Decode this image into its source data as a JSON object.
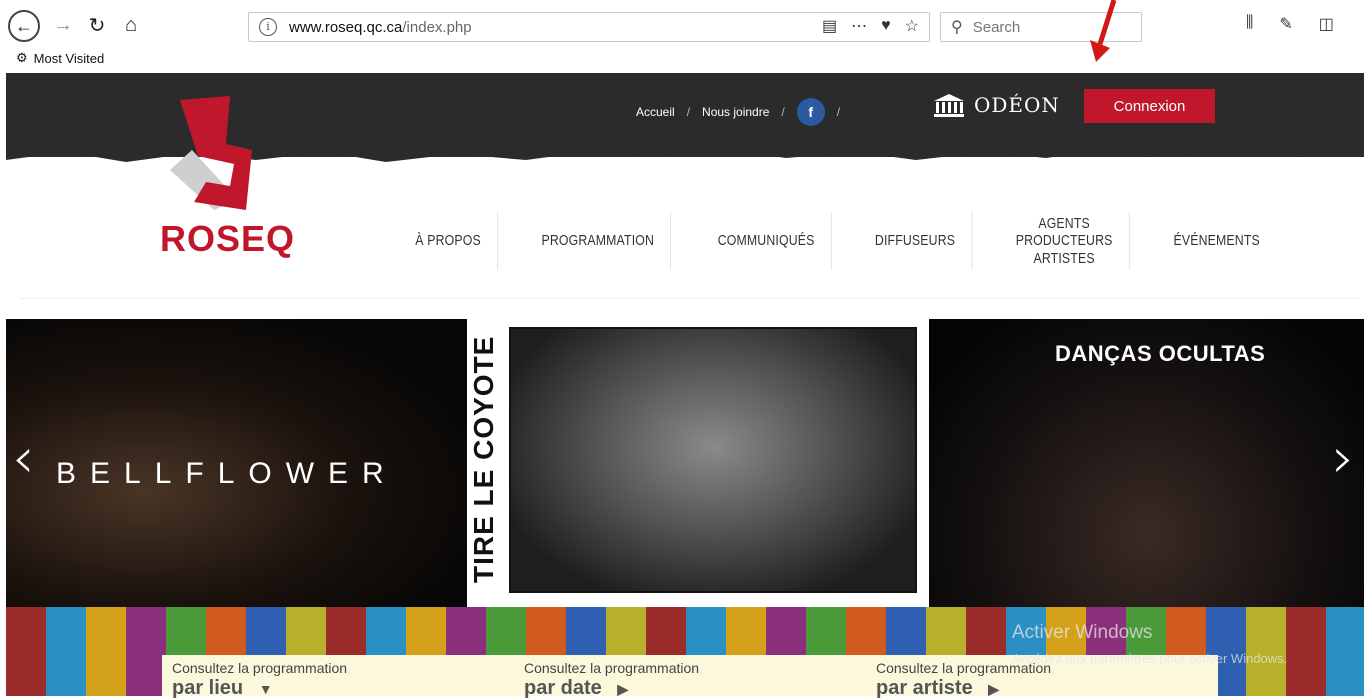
{
  "browser": {
    "url_domain": "www.roseq.qc.ca",
    "url_path": "/index.php",
    "search_placeholder": "Search",
    "bookmark_label": "Most Visited"
  },
  "header": {
    "links": [
      "Accueil",
      "Nous joindre"
    ],
    "separator": "/",
    "fb_label": "f",
    "odeon_label": "ODÉON",
    "connexion_label": "Connexion",
    "logo_text": "ROSEQ"
  },
  "nav": {
    "items": [
      {
        "label": "À PROPOS"
      },
      {
        "label": "PROGRAMMATION"
      },
      {
        "label": "COMMUNIQUÉS"
      },
      {
        "label": "DIFFUSEURS"
      },
      {
        "label": "AGENTS\nPRODUCTEURS\nARTISTES"
      },
      {
        "label": "ÉVÉNEMENTS"
      }
    ]
  },
  "carousel": {
    "slide_left": "BELLFLOWER",
    "slide_center": "TIRE LE COYOTE",
    "slide_right": "DANÇAS OCULTAS",
    "prev": "‹",
    "next": "›"
  },
  "consult": [
    {
      "small": "Consultez la programmation",
      "big": "par lieu",
      "icon": "▼"
    },
    {
      "small": "Consultez la programmation",
      "big": "par date",
      "icon": "▶"
    },
    {
      "small": "Consultez la programmation",
      "big": "par artiste",
      "icon": "▶"
    }
  ],
  "watermark": {
    "line1": "Activer Windows",
    "line2": "Accédez aux paramètres pour activer Windows."
  },
  "colors": {
    "brand_red": "#c0172d",
    "header_bg": "#2b2b2b",
    "facebook_blue": "#2c5aa0"
  }
}
